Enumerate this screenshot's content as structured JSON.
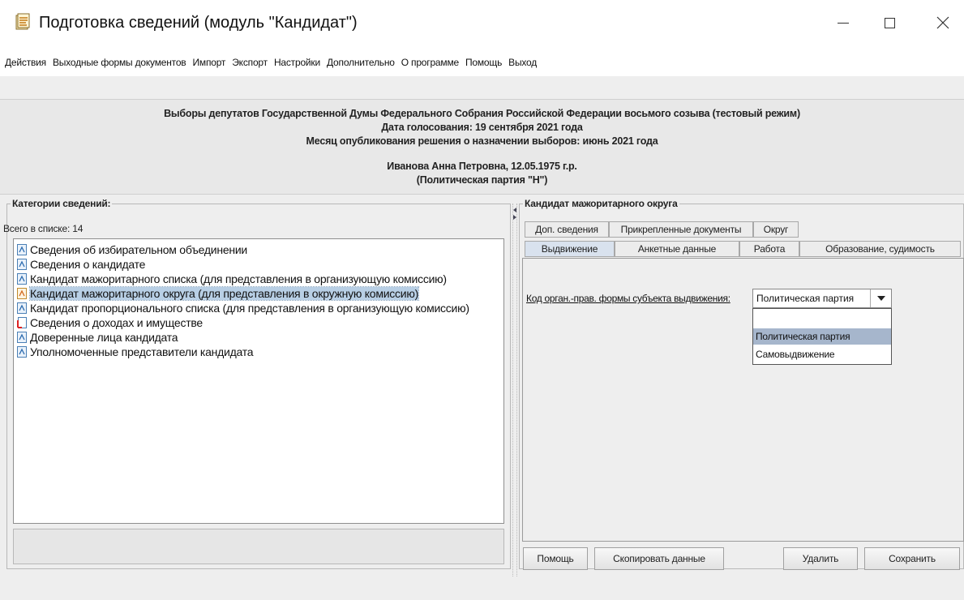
{
  "window": {
    "title": "Подготовка сведений (модуль \"Кандидат\")",
    "minimize_glyph": "—",
    "maximize_glyph": "☐",
    "close_glyph": "✕"
  },
  "menu": [
    "Действия",
    "Выходные формы документов",
    "Импорт",
    "Экспорт",
    "Настройки",
    "Дополнительно",
    "О программе",
    "Помощь",
    "Выход"
  ],
  "info": {
    "election": "Выборы депутатов Государственной Думы Федерального Собрания Российской Федерации восьмого созыва (тестовый режим)",
    "voting_date": "Дата голосования: 19 сентября 2021 года",
    "publication_month": "Месяц опубликования решения о назначении выборов: июнь 2021 года",
    "candidate": "Иванова Анна Петровна, 12.05.1975 г.р.",
    "party": "(Политическая партия \"Н\")"
  },
  "categories": {
    "legend": "Категории сведений:",
    "count_label": "Всего в списке: 14",
    "items": [
      {
        "label": "Сведения об избирательном объединении",
        "icon": "doc-icon"
      },
      {
        "label": "Сведения о кандидате",
        "icon": "doc-icon"
      },
      {
        "label": "Кандидат мажоритарного списка (для представления в организующую комиссию)",
        "icon": "doc-icon"
      },
      {
        "label": "Кандидат мажоритарного округа (для представления в окружную комиссию)",
        "icon": "doc-edit-icon"
      },
      {
        "label": "Кандидат пропорционального списка (для представления в организующую комиссию)",
        "icon": "doc-icon"
      },
      {
        "label": "Сведения о доходах и имуществе",
        "icon": "doc-red-icon"
      },
      {
        "label": "Доверенные лица кандидата",
        "icon": "doc-icon"
      },
      {
        "label": "Уполномоченные представители кандидата",
        "icon": "doc-icon"
      }
    ],
    "selected_index": 3
  },
  "detail": {
    "legend": "Кандидат мажоритарного округа",
    "tabs_row1": [
      "Доп. сведения",
      "Прикрепленные документы",
      "Округ"
    ],
    "tabs_row2": [
      "Выдвижение",
      "Анкетные данные",
      "Работа",
      "Образование, судимость"
    ],
    "active_tab": "Выдвижение",
    "field_label": "Код орган.-прав. формы субъекта выдвижения:",
    "combo_value": "Политическая партия",
    "options": [
      "",
      "Политическая партия",
      "Самовыдвижение"
    ],
    "highlighted_option": 1
  },
  "buttons": {
    "help": "Помощь",
    "copy": "Скопировать данные",
    "delete": "Удалить",
    "save": "Сохранить"
  },
  "colors": {
    "selection": "#b8cfe5",
    "highlight": "#a6b6cc",
    "background": "#eeeeee"
  }
}
